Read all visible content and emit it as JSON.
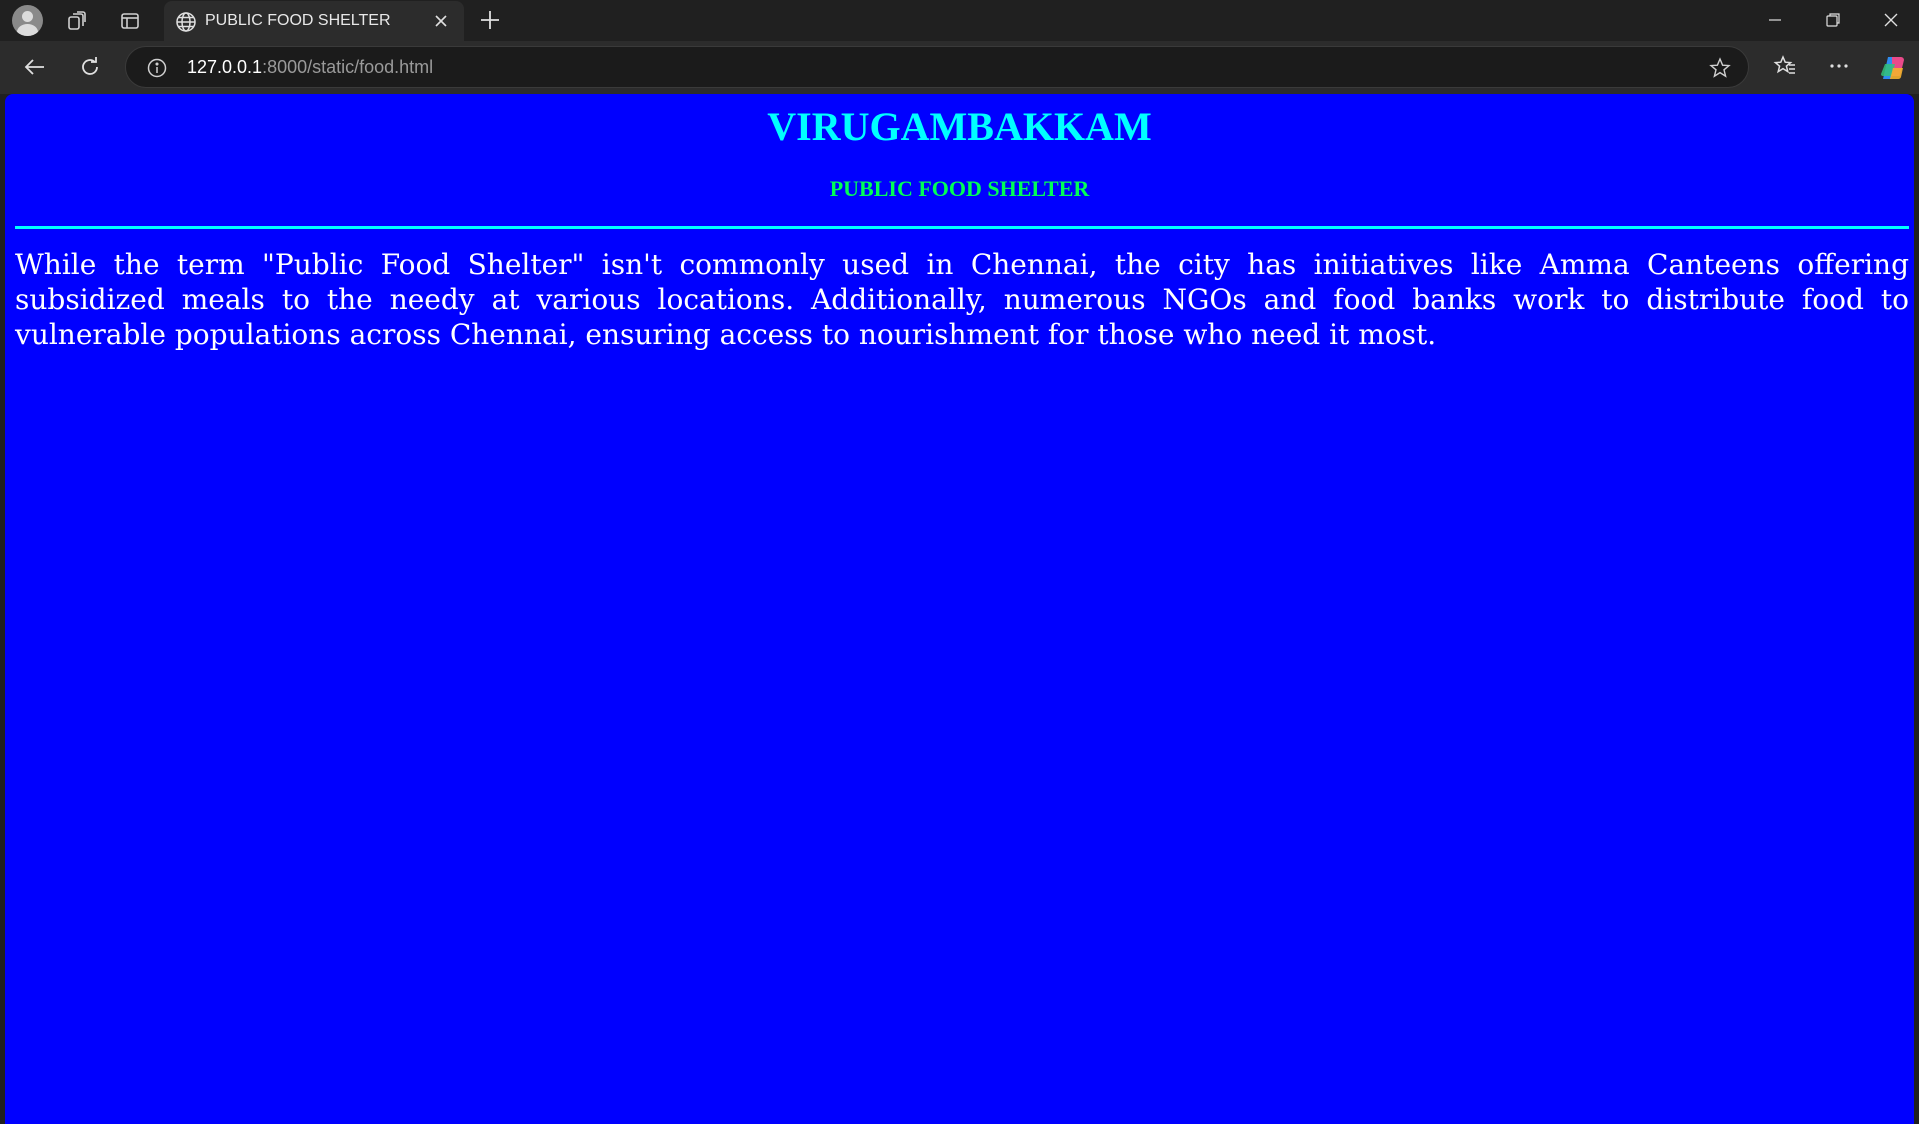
{
  "browser": {
    "tab": {
      "title": "PUBLIC FOOD SHELTER",
      "icon": "globe-icon"
    },
    "address": {
      "host": "127.0.0.1",
      "path": ":8000/static/food.html"
    },
    "icons": {
      "profile": "avatar-icon",
      "workspaces": "workspaces-icon",
      "tab_actions": "tab-actions-icon",
      "close_tab": "close-icon",
      "new_tab": "plus-icon",
      "minimize": "minimize-icon",
      "restore": "restore-icon",
      "close_window": "close-icon",
      "back": "back-arrow-icon",
      "refresh": "refresh-icon",
      "site_info": "info-icon",
      "favorite": "star-icon",
      "favorites": "favorites-icon",
      "more": "more-icon",
      "copilot": "copilot-icon"
    }
  },
  "page": {
    "heading": "VIRUGAMBAKKAM",
    "subheading": "PUBLIC FOOD SHELTER",
    "body": "While the term \"Public Food Shelter\" isn't commonly used in Chennai, the city has initiatives like Amma Canteens offering subsidized meals to the needy at various locations. Additionally, numerous NGOs and food banks work to distribute food to vulnerable populations across Chennai, ensuring access to nourishment for those who need it most.",
    "colors": {
      "background": "#0000ff",
      "heading": "#00ffff",
      "subheading": "#00ff55",
      "rule": "#00ffff",
      "body_text": "#ffffff"
    }
  }
}
